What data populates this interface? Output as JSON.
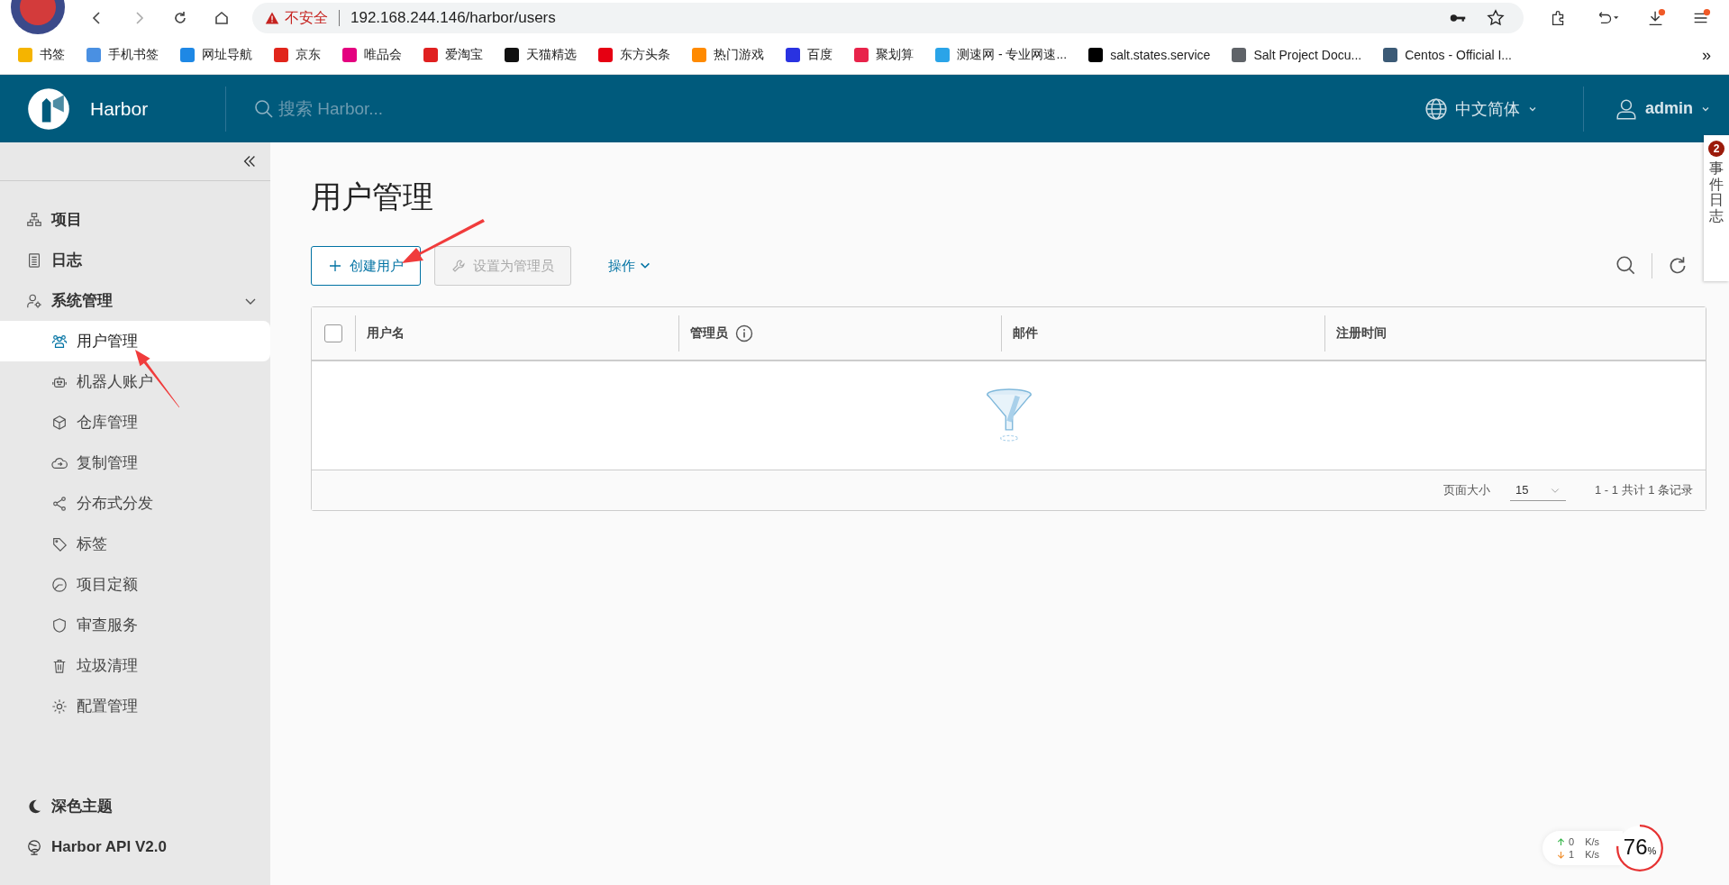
{
  "browser": {
    "security": "不安全",
    "url": "192.168.244.146/harbor/users",
    "bookmarks": [
      {
        "label": "书签",
        "color": "#f5b400"
      },
      {
        "label": "手机书签",
        "color": "#4a90e2"
      },
      {
        "label": "网址导航",
        "color": "#1e88e5"
      },
      {
        "label": "京东",
        "color": "#e1251b"
      },
      {
        "label": "唯品会",
        "color": "#e4007f"
      },
      {
        "label": "爱淘宝",
        "color": "#e02020"
      },
      {
        "label": "天猫精选",
        "color": "#111111"
      },
      {
        "label": "东方头条",
        "color": "#e60012"
      },
      {
        "label": "热门游戏",
        "color": "#ff8a00"
      },
      {
        "label": "百度",
        "color": "#2932e1"
      },
      {
        "label": "聚划算",
        "color": "#e8234a"
      },
      {
        "label": "测速网 - 专业网速...",
        "color": "#2aa4e8"
      },
      {
        "label": "salt.states.service",
        "color": "#000000"
      },
      {
        "label": "Salt Project Docu...",
        "color": "#5f6368"
      },
      {
        "label": "Centos - Official I...",
        "color": "#3b5a76"
      }
    ],
    "overflow": "»"
  },
  "header": {
    "brand": "Harbor",
    "search": {
      "placeholder": "搜索 Harbor..."
    },
    "language": "中文简体",
    "user": "admin"
  },
  "sidebar": {
    "items": [
      {
        "label": "项目",
        "selected": false
      },
      {
        "label": "日志",
        "selected": false
      },
      {
        "label": "系统管理",
        "selected": false,
        "expanded": true,
        "children": [
          {
            "label": "用户管理",
            "selected": true
          },
          {
            "label": "机器人账户",
            "selected": false
          },
          {
            "label": "仓库管理",
            "selected": false
          },
          {
            "label": "复制管理",
            "selected": false
          },
          {
            "label": "分布式分发",
            "selected": false
          },
          {
            "label": "标签",
            "selected": false
          },
          {
            "label": "项目定额",
            "selected": false
          },
          {
            "label": "审查服务",
            "selected": false
          },
          {
            "label": "垃圾清理",
            "selected": false
          },
          {
            "label": "配置管理",
            "selected": false
          }
        ]
      }
    ],
    "footer": [
      "深色主题",
      "Harbor API V2.0"
    ]
  },
  "page": {
    "title": "用户管理",
    "buttons": [
      {
        "label": "创建用户",
        "disabled": false
      },
      {
        "label": "设置为管理员",
        "disabled": true
      }
    ],
    "actions": "操作",
    "table": {
      "select_all": {
        "checked": false
      },
      "columns": [
        {
          "label": "用户名",
          "info": false
        },
        {
          "label": "管理员",
          "info": true
        },
        {
          "label": "邮件",
          "info": false
        },
        {
          "label": "注册时间",
          "info": false
        }
      ],
      "empty": true,
      "pagination": {
        "page_size_label": "页面大小",
        "page_size": "15",
        "summary": "1 - 1 共计 1 条记录"
      }
    }
  },
  "event_log": {
    "label": "事件日志",
    "count": "2"
  },
  "monitor": {
    "upload": "0",
    "download": "1",
    "unit_up": "K/s",
    "unit_down": "K/s",
    "percent": "76",
    "percent_sign": "%"
  }
}
